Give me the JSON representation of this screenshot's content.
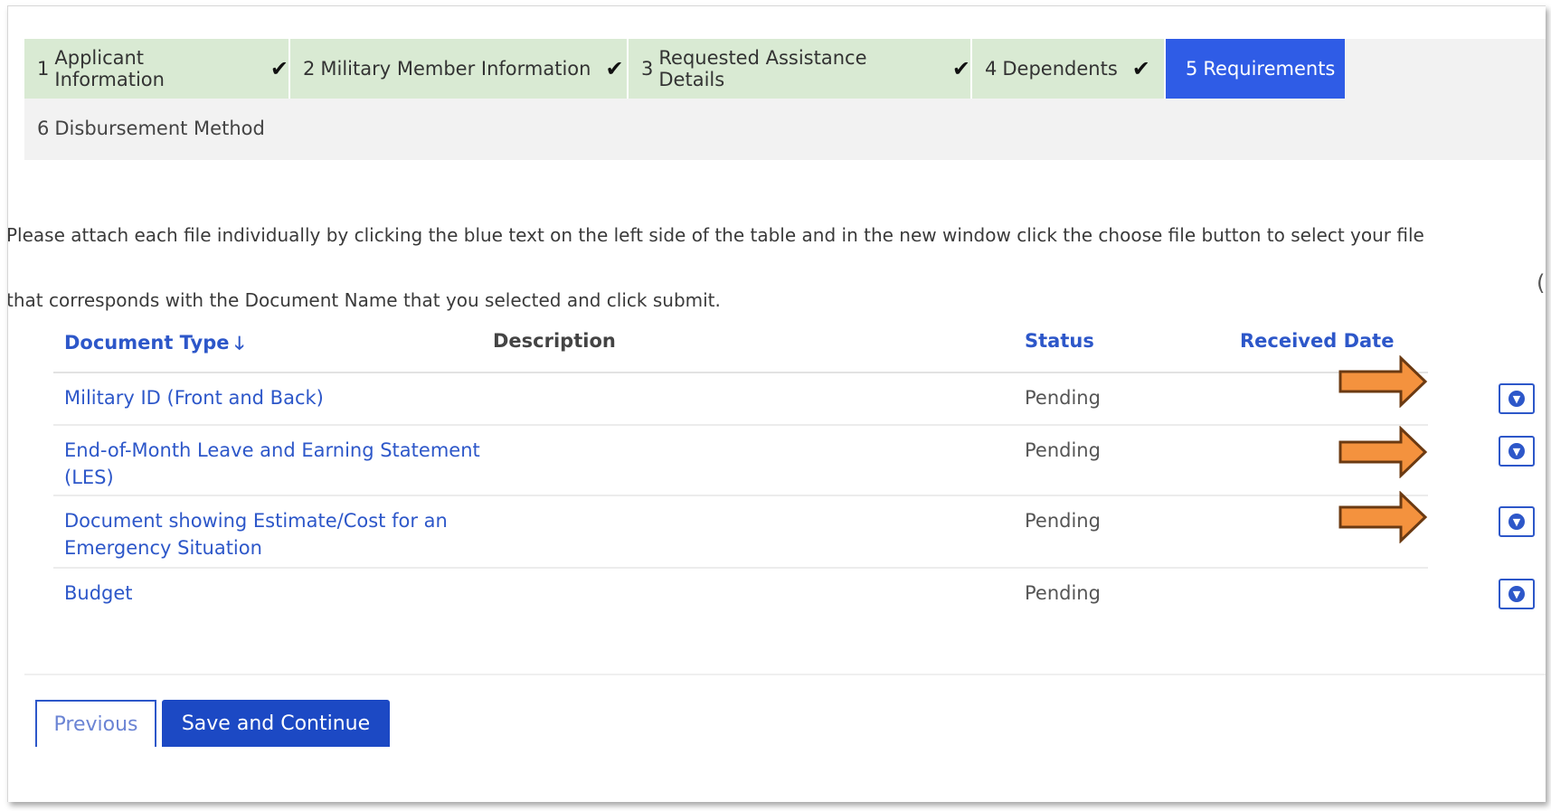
{
  "steps": [
    {
      "num": "1",
      "label": "Applicant Information",
      "complete": true
    },
    {
      "num": "2",
      "label": "Military Member Information",
      "complete": true
    },
    {
      "num": "3",
      "label": "Requested Assistance Details",
      "complete": true
    },
    {
      "num": "4",
      "label": "Dependents",
      "complete": true
    },
    {
      "num": "5",
      "label": "Requirements",
      "complete": false,
      "active": true
    },
    {
      "num": "6",
      "label": "Disbursement Method",
      "complete": false
    }
  ],
  "instructions": {
    "line1": "Please attach each file individually by clicking the blue text on the left side of the table and in the new window click the choose file button to select your file",
    "line2": "that corresponds with the Document Name that you selected and click submit."
  },
  "table": {
    "headers": {
      "document_type": "Document Type",
      "description": "Description",
      "status": "Status",
      "received_date": "Received Date"
    },
    "rows": [
      {
        "document_type": "Military ID (Front and Back)",
        "description": "",
        "status": "Pending",
        "received_date": "",
        "highlighted": true
      },
      {
        "document_type": "End-of-Month Leave and Earning Statement (LES)",
        "description": "",
        "status": "Pending",
        "received_date": "",
        "highlighted": true
      },
      {
        "document_type": "Document showing Estimate/Cost for an Emergency Situation",
        "description": "",
        "status": "Pending",
        "received_date": "",
        "highlighted": true
      },
      {
        "document_type": "Budget",
        "description": "",
        "status": "Pending",
        "received_date": "",
        "highlighted": false
      }
    ]
  },
  "buttons": {
    "previous": "Previous",
    "save_continue": "Save and Continue"
  },
  "icons": {
    "step_complete": "check-icon",
    "sort": "arrow-down-icon",
    "row_action": "chevron-down-circle-icon",
    "annotation": "orange-arrow-icon"
  },
  "colors": {
    "step_complete_bg": "#d9ead3",
    "step_active_bg": "#2f5ce6",
    "link": "#2d57c9",
    "primary_button": "#1c49c4",
    "annotation_arrow": "#f4923e"
  }
}
